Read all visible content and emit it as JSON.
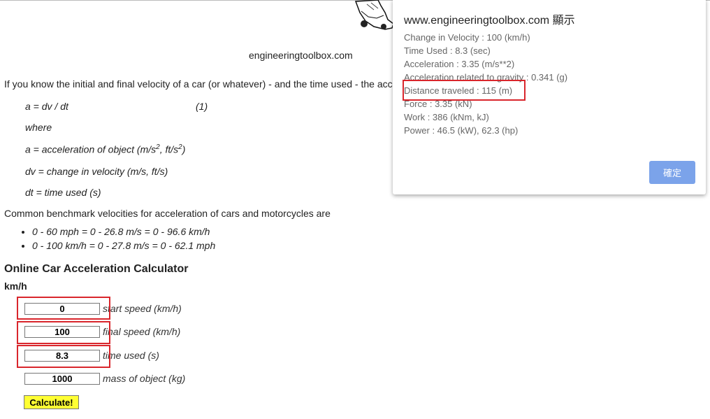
{
  "page": {
    "site_caption": "engineeringtoolbox.com",
    "intro": "If you know the initial and final velocity of a car (or whatever) - and the time used - the acceleration can be expressed as",
    "formula": "a = dv / dt",
    "eq_number": "(1)",
    "where": "where",
    "def_a_prefix": "a = acceleration of object (m/s",
    "def_a_mid": ", ft/s",
    "def_a_suffix": ")",
    "def_a_sup": "2",
    "def_dv": "dv = change in velocity (m/s, ft/s)",
    "def_dt": "dt = time used (s)",
    "benchmark_text": "Common benchmark velocities for acceleration of cars and motorcycles are",
    "benchmarks": [
      "0 - 60 mph = 0 - 26.8 m/s = 0 - 96.6 km/h",
      "0 - 100 km/h = 0 - 27.8 m/s = 0 - 62.1 mph"
    ]
  },
  "calculator": {
    "title": "Online Car Acceleration Calculator",
    "unit": "km/h",
    "fields": [
      {
        "value": "0",
        "label": "start speed (km/h)"
      },
      {
        "value": "100",
        "label": "final speed (km/h)"
      },
      {
        "value": "8.3",
        "label": "time used (s)"
      },
      {
        "value": "1000",
        "label": "mass of object (kg)"
      }
    ],
    "button": "Calculate!"
  },
  "dialog": {
    "title": "www.engineeringtoolbox.com 顯示",
    "lines": [
      "Change in Velocity : 100 (km/h)",
      "Time Used : 8.3 (sec)",
      "Acceleration : 3.35 (m/s**2)",
      "Acceleration related to gravity : 0.341 (g)",
      "Distance traveled : 115 (m)",
      "Force : 3.35 (kN)",
      "Work : 386 (kNm, kJ)",
      "Power : 46.5 (kW), 62.3 (hp)"
    ],
    "ok": "確定"
  },
  "colors": {
    "highlight": "#d9262c",
    "calc_button": "#ffff33",
    "ok_button": "#7ba3ea"
  }
}
